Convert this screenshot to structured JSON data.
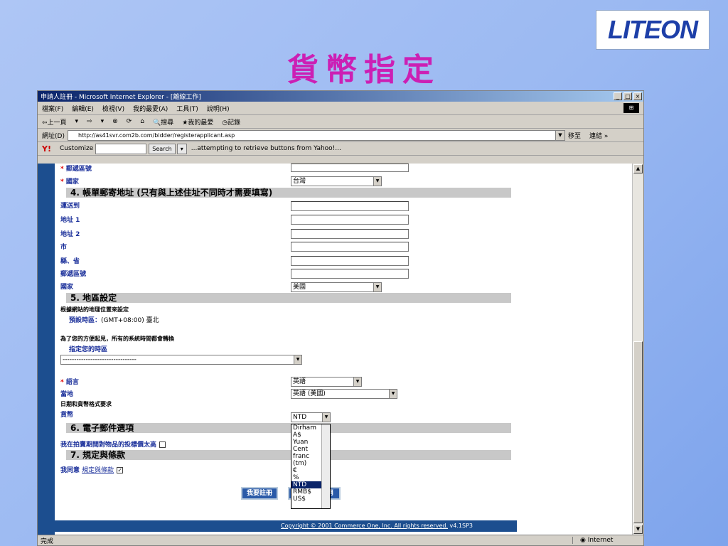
{
  "slide": {
    "title": "貨幣指定",
    "logo_text": "LITEON"
  },
  "ie": {
    "window_title": "申請人註冊 - Microsoft Internet Explorer - [離線工作]",
    "menu": [
      "檔案(F)",
      "編輯(E)",
      "檢視(V)",
      "我的最愛(A)",
      "工具(T)",
      "說明(H)"
    ],
    "toolbar": [
      "⇦上一頁",
      "▾",
      "⇨",
      "▾",
      "⊗",
      "⟳",
      "⌂",
      "🔍搜尋",
      "★我的最愛",
      "◷記錄"
    ],
    "address_label": "網址(D)",
    "address": "http://as41svr.com2b.com/bidder/registerapplicant.asp",
    "go_label": "移至",
    "links_label": "連結 »",
    "yahoo_customize": "Customize",
    "yahoo_search": "Search",
    "yahoo_status": "...attempting to retrieve buttons from Yahoo!...",
    "status_text": "完成",
    "status_zone": "Internet"
  },
  "form": {
    "postal_partial": "郵遞區號",
    "country_label": "國家",
    "country_value": "台灣",
    "sec4": "4. 帳單郵寄地址 (只有與上述住址不同時才需要填寫)",
    "ship_to": "運送到",
    "addr1": "地址 1",
    "addr2": "地址 2",
    "city": "市",
    "state": "縣、省",
    "postal": "郵遞區號",
    "country2": "國家",
    "country2_value": "美國",
    "sec5": "5. 地區設定",
    "region_note": "根據網站的地理位置來設定",
    "default_tz_label": "預設時區：",
    "default_tz_value": "(GMT+08:00) 臺北",
    "convert_note": "為了您的方便起見，所有的系統時間都會轉換",
    "specify_tz": "指定您的時區",
    "tz_value": "--------------------------------",
    "language_label": "語言",
    "language_value": "英語",
    "locale_label": "當地",
    "locale_value": "英語 (美國)",
    "format_note": "日期和貨幣格式要求",
    "currency_label": "貨幣",
    "currency_value": "NTD",
    "currency_options": [
      "Dirham",
      "A$",
      "Yuan",
      "Cent",
      "franc",
      "(tm)",
      "€",
      "%",
      "NTD",
      "RMB$",
      "US$"
    ],
    "sec6": "6. 電子郵件選項",
    "email_opt": "我在拍賣期間對物品的投標價太高",
    "sec7": "7. 規定與條款",
    "agree_prefix": "我同意",
    "agree_link": "規定與條款",
    "submit_label": "我要註冊",
    "cancel_label": "取消",
    "footer_link": "Copyright © 2001 Commerce One, Inc. All rights reserved.",
    "footer_version": "v4.1SP3"
  }
}
